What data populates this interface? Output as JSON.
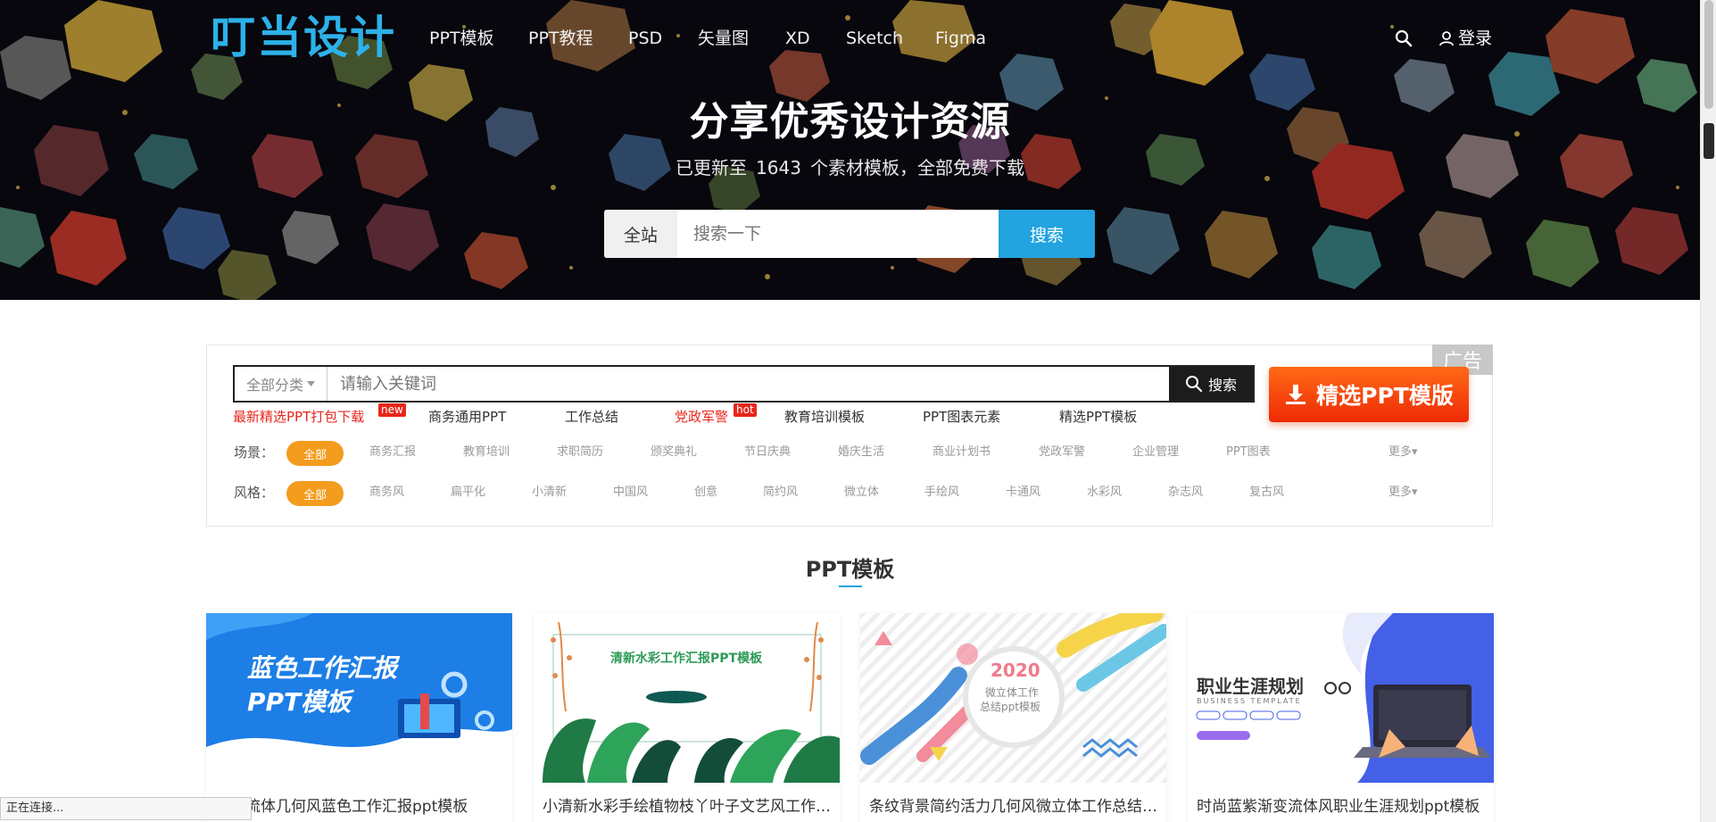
{
  "header": {
    "logo": "叮当设计",
    "nav": [
      "PPT模板",
      "PPT教程",
      "PSD",
      "矢量图",
      "XD",
      "Sketch",
      "Figma"
    ],
    "login_label": "登录",
    "search_icon": "search-icon",
    "user_icon": "user-icon"
  },
  "hero": {
    "title": "分享优秀设计资源",
    "subtitle_prefix": "已更新至",
    "count": "1643",
    "subtitle_suffix": "个素材模板，全部免费下载",
    "search_scope": "全站",
    "search_placeholder": "搜索一下",
    "search_button": "搜索"
  },
  "filter": {
    "ad_label": "广告",
    "category_label": "全部分类",
    "keyword_placeholder": "请输入关键词",
    "search_button": "搜索",
    "promo_label": "精选PPT模版",
    "hot_links": [
      {
        "label": "最新精选PPT打包下载",
        "badge": "new",
        "red": true
      },
      {
        "label": "商务通用PPT",
        "badge": "",
        "red": false
      },
      {
        "label": "工作总结",
        "badge": "",
        "red": false
      },
      {
        "label": "党政军警",
        "badge": "hot",
        "red": true
      },
      {
        "label": "教育培训模板",
        "badge": "",
        "red": false
      },
      {
        "label": "PPT图表元素",
        "badge": "",
        "red": false
      },
      {
        "label": "精选PPT模板",
        "badge": "",
        "red": false
      }
    ],
    "scene": {
      "label": "场景：",
      "all": "全部",
      "items": [
        "商务汇报",
        "教育培训",
        "求职简历",
        "颁奖典礼",
        "节日庆典",
        "婚庆生活",
        "商业计划书",
        "党政军警",
        "企业管理",
        "PPT图表"
      ],
      "more": "更多"
    },
    "style": {
      "label": "风格：",
      "all": "全部",
      "items": [
        "商务风",
        "扁平化",
        "小清新",
        "中国风",
        "创意",
        "简约风",
        "微立体",
        "手绘风",
        "卡通风",
        "水彩风",
        "杂志风",
        "复古风"
      ],
      "more": "更多"
    },
    "accent_color": "#f39c1e"
  },
  "section": {
    "title": "PPT模板",
    "cards": [
      {
        "title": "图表流体几何风蓝色工作汇报ppt模板",
        "thumb_line1": "蓝色工作汇报",
        "thumb_line2": "PPT模板"
      },
      {
        "title": "小清新水彩手绘植物枝丫叶子文艺风工作汇报PPT模板",
        "thumb_line1": "清新水彩工作汇报PPT模板",
        "thumb_line2": ""
      },
      {
        "title": "条纹背景简约活力几何风微立体工作总结ppt模板",
        "thumb_line1": "2020",
        "thumb_line2": "微立体工作",
        "thumb_line3": "总结ppt模板"
      },
      {
        "title": "时尚蓝紫渐变流体风职业生涯规划ppt模板",
        "thumb_line1": "职业生涯规划",
        "thumb_line2": "BUSINESS TEMPLATE"
      }
    ]
  },
  "status_bar": {
    "text": "正在连接..."
  },
  "colors": {
    "brand_blue": "#23a3e0",
    "promo_orange": "#ff5a10",
    "hot_red": "#e8261b"
  }
}
